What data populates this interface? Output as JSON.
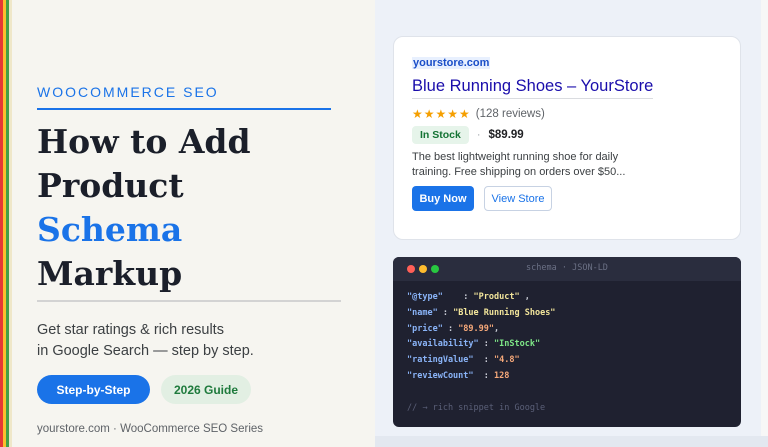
{
  "colors": {
    "accent_blue": "#1a73e8",
    "stripe_red": "#e53935",
    "stripe_green": "#43a047",
    "stripe_yellow": "#fbc02d",
    "stock_green": "#137333",
    "star_yellow": "#f59f00",
    "code_bg": "#1f2130"
  },
  "left": {
    "eyebrow": "WOOCOMMERCE SEO",
    "headline": {
      "line1": "How to Add",
      "line2": "Product",
      "line3_accent": "Schema",
      "line4": "Markup"
    },
    "subtitle": {
      "line1": "Get star ratings & rich results",
      "line2": "in Google Search — step by step."
    },
    "pill_primary": "Step-by-Step",
    "pill_secondary": "2026 Guide",
    "footer": "yourstore.com · WooCommerce SEO Series"
  },
  "serp": {
    "url": "yourstore.com",
    "title": "Blue Running Shoes – YourStore",
    "stars": "★★★★★",
    "star_icon": "star-icon",
    "reviews": "(128 reviews)",
    "rating_stars_shown": 5,
    "stock_badge": "In Stock",
    "separator": "·",
    "price": "$89.99",
    "description": {
      "line1": "The best lightweight running shoe for daily",
      "line2": "training. Free shipping on orders over $50..."
    },
    "buy_button": "Buy Now",
    "view_button": "View Store"
  },
  "code": {
    "window_title": "schema · JSON-LD",
    "lines": [
      {
        "key": "\"@type\"",
        "pad": "    : ",
        "value": "\"Product\"",
        "tail": " ,",
        "vtype": "s"
      },
      {
        "key": "\"name\"",
        "pad": " : ",
        "value": "\"Blue Running Shoes\"",
        "tail": "",
        "vtype": "s"
      },
      {
        "key": "\"price\"",
        "pad": " : ",
        "value": "\"89.99\"",
        "tail": ",",
        "vtype": "n"
      },
      {
        "key": "\"availability\"",
        "pad": " : ",
        "value": "\"InStock\"",
        "tail": "",
        "vtype": "g"
      },
      {
        "key": "\"ratingValue\"",
        "pad": "  : ",
        "value": "\"4.8\"",
        "tail": "",
        "vtype": "n"
      },
      {
        "key": "\"reviewCount\"",
        "pad": "  : ",
        "value": "128",
        "tail": "",
        "vtype": "n"
      }
    ],
    "comment": "// → rich snippet in Google"
  }
}
